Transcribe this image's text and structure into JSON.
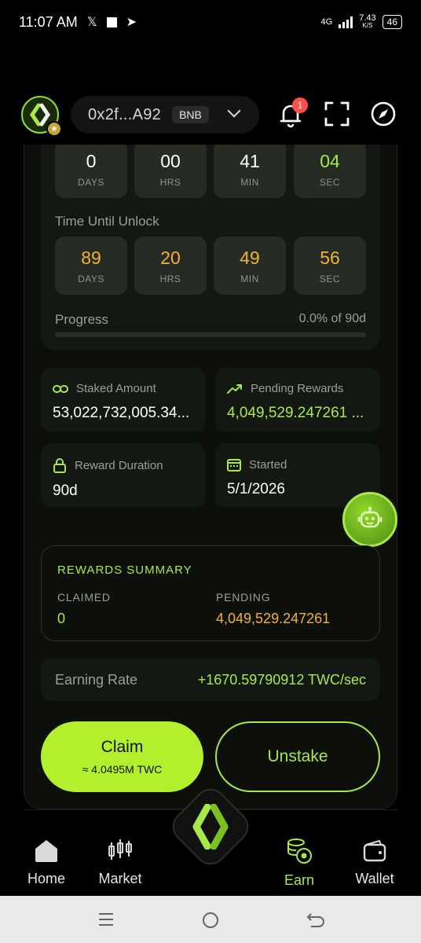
{
  "status_bar": {
    "time": "11:07 AM",
    "network": "4G",
    "speed": "7.43",
    "speed_unit": "K/S",
    "battery": "46"
  },
  "header": {
    "wallet_address": "0x2f...A92",
    "chain": "BNB",
    "notification_count": "1"
  },
  "countdown_top": [
    {
      "value": "0",
      "unit": "DAYS"
    },
    {
      "value": "00",
      "unit": "HRS"
    },
    {
      "value": "41",
      "unit": "MIN"
    },
    {
      "value": "04",
      "unit": "SEC"
    }
  ],
  "unlock": {
    "label": "Time Until Unlock",
    "boxes": [
      {
        "value": "89",
        "unit": "DAYS"
      },
      {
        "value": "20",
        "unit": "HRS"
      },
      {
        "value": "49",
        "unit": "MIN"
      },
      {
        "value": "56",
        "unit": "SEC"
      }
    ]
  },
  "progress": {
    "label": "Progress",
    "text": "0.0% of 90d",
    "fraction": 0.0
  },
  "stats": {
    "staked_label": "Staked Amount",
    "staked_value": "53,022,732,005.34...",
    "pending_label": "Pending Rewards",
    "pending_value": "4,049,529.247261 ...",
    "duration_label": "Reward Duration",
    "duration_value": "90d",
    "started_label": "Started",
    "started_value": "5/1/2026"
  },
  "summary": {
    "title": "REWARDS SUMMARY",
    "claimed_label": "CLAIMED",
    "claimed_value": "0",
    "pending_label": "PENDING",
    "pending_value": "4,049,529.247261"
  },
  "earning": {
    "label": "Earning Rate",
    "value": "+1670.59790912 TWC/sec"
  },
  "actions": {
    "claim_label": "Claim",
    "claim_sub": "≈ 4.0495M TWC",
    "unstake_label": "Unstake"
  },
  "nav": {
    "home": "Home",
    "market": "Market",
    "earn": "Earn",
    "wallet": "Wallet"
  },
  "colors": {
    "accent": "#a7e84a",
    "pending_orange": "#f2b233",
    "card_bg": "#141812"
  }
}
